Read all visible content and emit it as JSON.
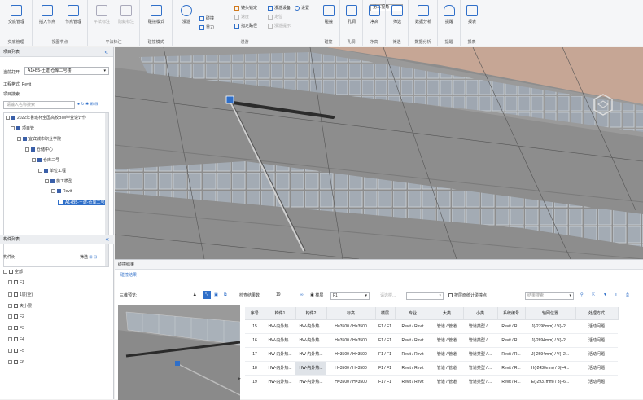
{
  "ribbon": {
    "groups": [
      {
        "label": "交底管理",
        "buttons": [
          {
            "label": "交底管理",
            "icon": "document-icon",
            "enabled": true
          }
        ]
      },
      {
        "label": "视图节点",
        "buttons": [
          {
            "label": "插入节点",
            "icon": "insert-node-icon",
            "enabled": true
          },
          {
            "label": "节点管理",
            "icon": "node-manage-icon",
            "enabled": true
          }
        ]
      },
      {
        "label": "平法标注",
        "buttons": [
          {
            "label": "平法标注",
            "icon": "annotation-icon",
            "enabled": false
          },
          {
            "label": "隐藏标注",
            "icon": "hide-annotation-icon",
            "enabled": false
          }
        ]
      },
      {
        "label": "碰撞模式",
        "buttons": [
          {
            "label": "碰撞模式",
            "icon": "collision-mode-icon",
            "enabled": true
          }
        ]
      },
      {
        "label": "漫游",
        "buttons": [
          {
            "label": "漫游",
            "icon": "roam-icon",
            "enabled": true
          }
        ]
      },
      {
        "label": "碰撞",
        "buttons": [
          {
            "label": "碰撞",
            "icon": "collision-icon",
            "enabled": true
          }
        ]
      },
      {
        "label": "孔洞",
        "buttons": [
          {
            "label": "孔洞",
            "icon": "hole-icon",
            "enabled": true
          }
        ]
      },
      {
        "label": "净高",
        "buttons": [
          {
            "label": "净高",
            "icon": "clear-height-icon",
            "enabled": true
          }
        ]
      },
      {
        "label": "筛选",
        "buttons": [
          {
            "label": "筛选",
            "icon": "filter-icon",
            "enabled": true
          }
        ]
      },
      {
        "label": "数据分析",
        "buttons": [
          {
            "label": "数据分析",
            "icon": "data-analysis-icon",
            "enabled": true
          }
        ]
      },
      {
        "label": "提醒",
        "buttons": [
          {
            "label": "提醒",
            "icon": "bell-icon",
            "enabled": true
          }
        ]
      },
      {
        "label": "报表",
        "buttons": [
          {
            "label": "报表",
            "icon": "report-icon",
            "enabled": true
          }
        ]
      }
    ],
    "roam": {
      "view_select": "第三视角",
      "gravity_label": "重力",
      "collide_label": "碰撞",
      "lens_lock": "镜头锁定",
      "walk_path": "指定路径",
      "speed_label": "速度",
      "roam_device": "漫游设备",
      "settings": "设置",
      "position": "定位",
      "roam_prompt": "漫游提示"
    }
  },
  "left_panel": {
    "title": "项目列表",
    "current_open_label": "当前打开:",
    "current_open_value": "A1+B5-土建-仓库二号楼",
    "engineering_label": "工程格式:",
    "engineering_value": "Revit",
    "project_search_label": "项目搜索:",
    "search_placeholder": "请输入名称搜索",
    "tree": [
      {
        "label": "2022年鲁班杯全国高校BIM毕业设计作"
      },
      {
        "label": "项目管"
      },
      {
        "label": "宜宾城市职业学院"
      },
      {
        "label": "仓储中心"
      },
      {
        "label": "仓库二号"
      },
      {
        "label": "单位工程"
      },
      {
        "label": "施工模型"
      },
      {
        "label": "Revit"
      },
      {
        "label": "A1+B5-土建-仓库二号楼"
      }
    ]
  },
  "component_panel": {
    "title": "构件列表",
    "tree_label": "构件树",
    "filter_label": "筛选",
    "items": [
      {
        "label": "全部"
      },
      {
        "label": "F1"
      },
      {
        "label": "1层(全)"
      },
      {
        "label": "夹小层"
      },
      {
        "label": "F2"
      },
      {
        "label": "F3"
      },
      {
        "label": "F4"
      },
      {
        "label": "F5"
      },
      {
        "label": "F6"
      }
    ]
  },
  "bottom": {
    "title": "碰撞结果",
    "tab": "碰撞结果",
    "preview_label": "三维预览:",
    "count_label": "检查结果数",
    "count_value": "19",
    "floor_label": "楼层",
    "floor_value": "F1",
    "status_placeholder": "请选楼...",
    "clash_checkbox_label": "按层面统计碰撞点",
    "search_placeholder": "结果搜索",
    "columns": [
      "序号",
      "构件1",
      "构件2",
      "标高",
      "楼层",
      "专业",
      "大类",
      "小类",
      "系统编号",
      "轴网位置",
      "处理方式"
    ],
    "rows": [
      [
        "15",
        "HW-内外热...",
        "HW-内外热...",
        "H=3500 / H=3500",
        "F1 / F1",
        "Revit / Revit",
        "管道 / 管道",
        "管道类型 / ...",
        "Revit / R...",
        "J(-2798mm) / V(+2...",
        "活动问题"
      ],
      [
        "16",
        "HW-内外热...",
        "HW-内外热...",
        "H=3500 / H=3500",
        "F1 / F1",
        "Revit / Revit",
        "管道 / 管道",
        "管道类型 / ...",
        "Revit / R...",
        "J(-2694mm) / V(+2...",
        "活动问题"
      ],
      [
        "17",
        "HW-内外热...",
        "HW-内外热...",
        "H=3500 / H=3500",
        "F1 / F1",
        "Revit / Revit",
        "管道 / 管道",
        "管道类型 / ...",
        "Revit / R...",
        "J(-2694mm) / V(+2...",
        "活动问题"
      ],
      [
        "18",
        "HW-内外热...",
        "HW-内外热...",
        "H=3500 / H=3500",
        "F1 / F1",
        "Revit / Revit",
        "管道 / 管道",
        "管道类型 / ...",
        "Revit / R...",
        "H(-2430mm) / 3(+4...",
        "活动问题"
      ],
      [
        "19",
        "HW-内外热...",
        "HW-内外热...",
        "H=3500 / H=3500",
        "F1 / F1",
        "Revit / Revit",
        "管道 / 管道",
        "管道类型 / ...",
        "Revit / R...",
        "E(-2937mm) / 3(+6...",
        "活动问题"
      ]
    ],
    "selected_row_index": 3
  },
  "colors": {
    "accent": "#2f6fc9",
    "pipe": "#2b2b2b",
    "ceiling": "#9a9a9a",
    "wall": "#c7a797"
  }
}
